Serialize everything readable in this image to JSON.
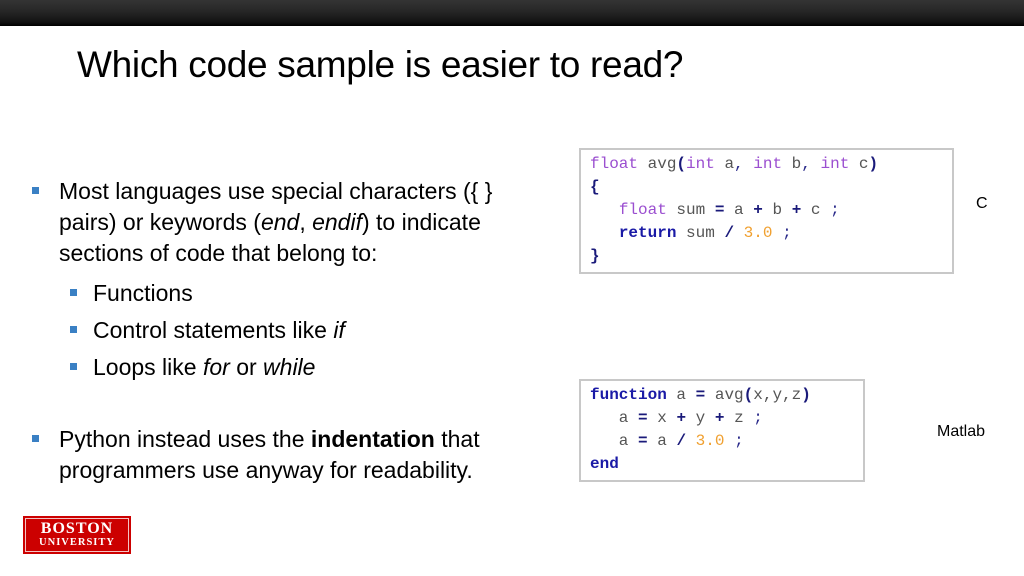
{
  "slide": {
    "title": "Which code sample is easier to read?",
    "bullets": [
      {
        "segments": [
          {
            "text": "Most languages use special characters ({ } pairs) or keywords (",
            "style": "normal"
          },
          {
            "text": "end",
            "style": "italic"
          },
          {
            "text": ", ",
            "style": "normal"
          },
          {
            "text": "endif",
            "style": "italic"
          },
          {
            "text": ") to indicate sections of code that belong to:",
            "style": "normal"
          }
        ],
        "sub_bullets": [
          {
            "segments": [
              {
                "text": "Functions",
                "style": "normal"
              }
            ]
          },
          {
            "segments": [
              {
                "text": "Control statements like ",
                "style": "normal"
              },
              {
                "text": "if",
                "style": "italic"
              }
            ]
          },
          {
            "segments": [
              {
                "text": "Loops like ",
                "style": "normal"
              },
              {
                "text": "for",
                "style": "italic"
              },
              {
                "text": " or ",
                "style": "normal"
              },
              {
                "text": "while",
                "style": "italic"
              }
            ]
          }
        ]
      },
      {
        "segments": [
          {
            "text": "Python instead uses the ",
            "style": "normal"
          },
          {
            "text": "indentation",
            "style": "bold"
          },
          {
            "text": " that programmers use anyway for readability.",
            "style": "normal"
          }
        ]
      }
    ],
    "code_samples": [
      {
        "language_label": "C",
        "lines": [
          [
            [
              "float",
              "kw-type"
            ],
            [
              " avg",
              "ident"
            ],
            [
              "(",
              "op"
            ],
            [
              "int",
              "kw-type"
            ],
            [
              " a",
              "ident"
            ],
            [
              ",",
              "punc"
            ],
            [
              " ",
              "ident"
            ],
            [
              "int",
              "kw-type"
            ],
            [
              " b",
              "ident"
            ],
            [
              ",",
              "punc"
            ],
            [
              " ",
              "ident"
            ],
            [
              "int",
              "kw-type"
            ],
            [
              " c",
              "ident"
            ],
            [
              ")",
              "op"
            ]
          ],
          [
            [
              "{",
              "brace"
            ]
          ],
          [
            [
              "   ",
              "ident"
            ],
            [
              "float",
              "kw-type"
            ],
            [
              " sum ",
              "ident"
            ],
            [
              "=",
              "op"
            ],
            [
              " a ",
              "ident"
            ],
            [
              "+",
              "op"
            ],
            [
              " b ",
              "ident"
            ],
            [
              "+",
              "op"
            ],
            [
              " c ",
              "ident"
            ],
            [
              ";",
              "punc"
            ]
          ],
          [
            [
              "   ",
              "ident"
            ],
            [
              "return",
              "kw-ctrl"
            ],
            [
              " sum ",
              "ident"
            ],
            [
              "/",
              "op"
            ],
            [
              " ",
              "ident"
            ],
            [
              "3.0",
              "num"
            ],
            [
              " ",
              "ident"
            ],
            [
              ";",
              "punc"
            ]
          ],
          [
            [
              "}",
              "brace"
            ]
          ]
        ]
      },
      {
        "language_label": "Matlab",
        "lines": [
          [
            [
              "function",
              "kw-ctrl"
            ],
            [
              " a ",
              "ident"
            ],
            [
              "=",
              "op"
            ],
            [
              " avg",
              "ident"
            ],
            [
              "(",
              "op"
            ],
            [
              "x,y,z",
              "ident"
            ],
            [
              ")",
              "op"
            ]
          ],
          [
            [
              "   a ",
              "ident"
            ],
            [
              "=",
              "op"
            ],
            [
              " x ",
              "ident"
            ],
            [
              "+",
              "op"
            ],
            [
              " y ",
              "ident"
            ],
            [
              "+",
              "op"
            ],
            [
              " z ",
              "ident"
            ],
            [
              ";",
              "punc"
            ]
          ],
          [
            [
              "   a ",
              "ident"
            ],
            [
              "=",
              "op"
            ],
            [
              " a ",
              "ident"
            ],
            [
              "/",
              "op"
            ],
            [
              " ",
              "ident"
            ],
            [
              "3.0",
              "num"
            ],
            [
              " ",
              "ident"
            ],
            [
              ";",
              "punc"
            ]
          ],
          [
            [
              "end",
              "kw-ctrl"
            ]
          ]
        ]
      }
    ],
    "logo": {
      "line1": "BOSTON",
      "line2": "UNIVERSITY",
      "color": "#cc0000"
    },
    "colors": {
      "bullet_marker": "#3a80c4",
      "type_keyword": "#9b4fd0",
      "control_keyword": "#1a1aa6",
      "number_literal": "#f0a030",
      "identifier": "#555555",
      "code_border": "#c8c8c8"
    }
  }
}
